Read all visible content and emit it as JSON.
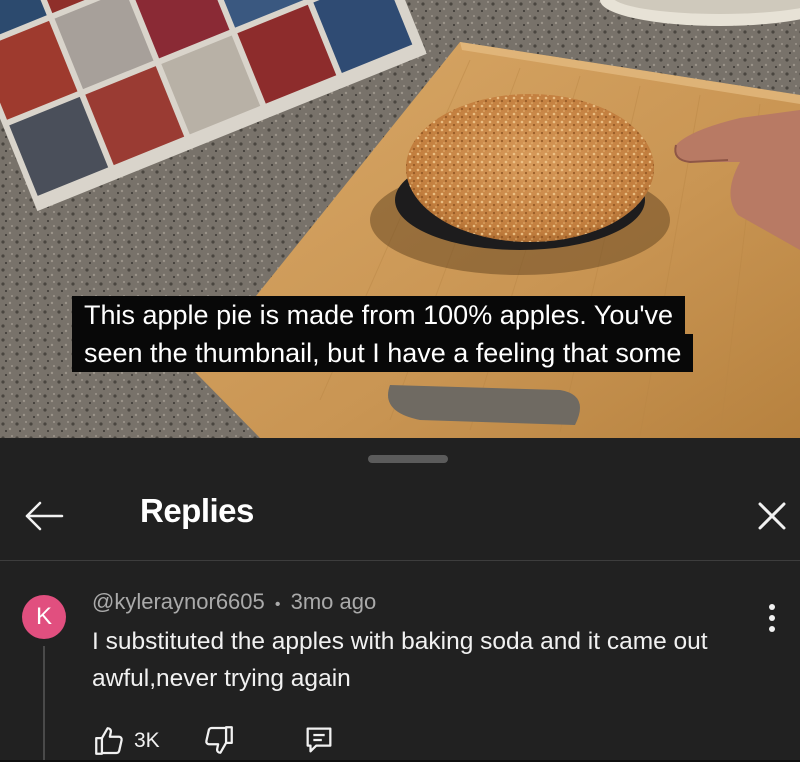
{
  "video": {
    "caption_lines": [
      "This apple pie is made from 100% apples. You've",
      "seen the thumbnail, but I have a feeling that some"
    ]
  },
  "replies_panel": {
    "title": "Replies",
    "back_icon": "arrow-left-icon",
    "close_icon": "close-icon"
  },
  "comment": {
    "avatar_initial": "K",
    "avatar_color": "#e14f7f",
    "author": "@kyleraynor6605",
    "separator": "•",
    "time": "3mo ago",
    "text": "I substituted the apples with baking soda and it came out awful,never trying again",
    "like_count": "3K",
    "icons": [
      "thumbs-up-icon",
      "thumbs-down-icon",
      "reply-icon",
      "more-vertical-icon"
    ]
  },
  "colors": {
    "sheet_background": "#212121",
    "caption_background": "#080808"
  }
}
